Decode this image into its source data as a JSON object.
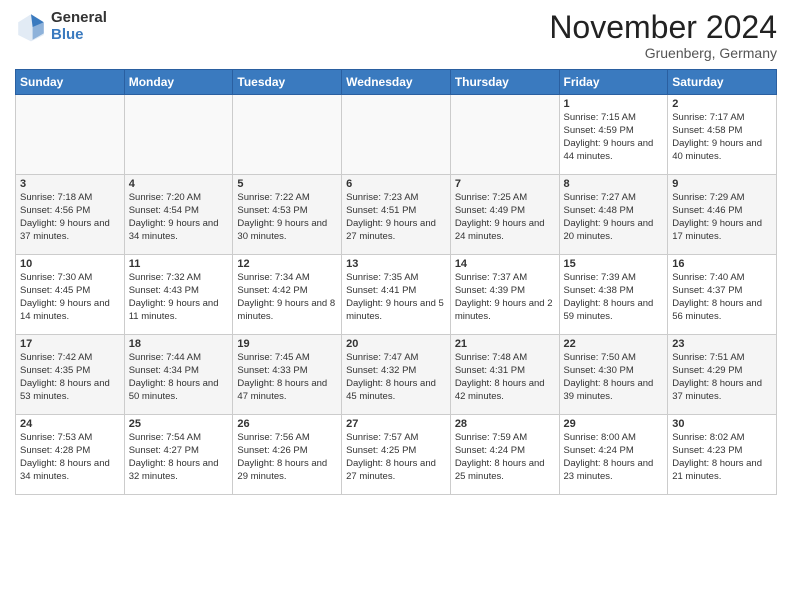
{
  "logo": {
    "general": "General",
    "blue": "Blue"
  },
  "header": {
    "month": "November 2024",
    "location": "Gruenberg, Germany"
  },
  "days_of_week": [
    "Sunday",
    "Monday",
    "Tuesday",
    "Wednesday",
    "Thursday",
    "Friday",
    "Saturday"
  ],
  "weeks": [
    [
      {
        "day": "",
        "info": ""
      },
      {
        "day": "",
        "info": ""
      },
      {
        "day": "",
        "info": ""
      },
      {
        "day": "",
        "info": ""
      },
      {
        "day": "",
        "info": ""
      },
      {
        "day": "1",
        "info": "Sunrise: 7:15 AM\nSunset: 4:59 PM\nDaylight: 9 hours\nand 44 minutes."
      },
      {
        "day": "2",
        "info": "Sunrise: 7:17 AM\nSunset: 4:58 PM\nDaylight: 9 hours\nand 40 minutes."
      }
    ],
    [
      {
        "day": "3",
        "info": "Sunrise: 7:18 AM\nSunset: 4:56 PM\nDaylight: 9 hours\nand 37 minutes."
      },
      {
        "day": "4",
        "info": "Sunrise: 7:20 AM\nSunset: 4:54 PM\nDaylight: 9 hours\nand 34 minutes."
      },
      {
        "day": "5",
        "info": "Sunrise: 7:22 AM\nSunset: 4:53 PM\nDaylight: 9 hours\nand 30 minutes."
      },
      {
        "day": "6",
        "info": "Sunrise: 7:23 AM\nSunset: 4:51 PM\nDaylight: 9 hours\nand 27 minutes."
      },
      {
        "day": "7",
        "info": "Sunrise: 7:25 AM\nSunset: 4:49 PM\nDaylight: 9 hours\nand 24 minutes."
      },
      {
        "day": "8",
        "info": "Sunrise: 7:27 AM\nSunset: 4:48 PM\nDaylight: 9 hours\nand 20 minutes."
      },
      {
        "day": "9",
        "info": "Sunrise: 7:29 AM\nSunset: 4:46 PM\nDaylight: 9 hours\nand 17 minutes."
      }
    ],
    [
      {
        "day": "10",
        "info": "Sunrise: 7:30 AM\nSunset: 4:45 PM\nDaylight: 9 hours\nand 14 minutes."
      },
      {
        "day": "11",
        "info": "Sunrise: 7:32 AM\nSunset: 4:43 PM\nDaylight: 9 hours\nand 11 minutes."
      },
      {
        "day": "12",
        "info": "Sunrise: 7:34 AM\nSunset: 4:42 PM\nDaylight: 9 hours\nand 8 minutes."
      },
      {
        "day": "13",
        "info": "Sunrise: 7:35 AM\nSunset: 4:41 PM\nDaylight: 9 hours\nand 5 minutes."
      },
      {
        "day": "14",
        "info": "Sunrise: 7:37 AM\nSunset: 4:39 PM\nDaylight: 9 hours\nand 2 minutes."
      },
      {
        "day": "15",
        "info": "Sunrise: 7:39 AM\nSunset: 4:38 PM\nDaylight: 8 hours\nand 59 minutes."
      },
      {
        "day": "16",
        "info": "Sunrise: 7:40 AM\nSunset: 4:37 PM\nDaylight: 8 hours\nand 56 minutes."
      }
    ],
    [
      {
        "day": "17",
        "info": "Sunrise: 7:42 AM\nSunset: 4:35 PM\nDaylight: 8 hours\nand 53 minutes."
      },
      {
        "day": "18",
        "info": "Sunrise: 7:44 AM\nSunset: 4:34 PM\nDaylight: 8 hours\nand 50 minutes."
      },
      {
        "day": "19",
        "info": "Sunrise: 7:45 AM\nSunset: 4:33 PM\nDaylight: 8 hours\nand 47 minutes."
      },
      {
        "day": "20",
        "info": "Sunrise: 7:47 AM\nSunset: 4:32 PM\nDaylight: 8 hours\nand 45 minutes."
      },
      {
        "day": "21",
        "info": "Sunrise: 7:48 AM\nSunset: 4:31 PM\nDaylight: 8 hours\nand 42 minutes."
      },
      {
        "day": "22",
        "info": "Sunrise: 7:50 AM\nSunset: 4:30 PM\nDaylight: 8 hours\nand 39 minutes."
      },
      {
        "day": "23",
        "info": "Sunrise: 7:51 AM\nSunset: 4:29 PM\nDaylight: 8 hours\nand 37 minutes."
      }
    ],
    [
      {
        "day": "24",
        "info": "Sunrise: 7:53 AM\nSunset: 4:28 PM\nDaylight: 8 hours\nand 34 minutes."
      },
      {
        "day": "25",
        "info": "Sunrise: 7:54 AM\nSunset: 4:27 PM\nDaylight: 8 hours\nand 32 minutes."
      },
      {
        "day": "26",
        "info": "Sunrise: 7:56 AM\nSunset: 4:26 PM\nDaylight: 8 hours\nand 29 minutes."
      },
      {
        "day": "27",
        "info": "Sunrise: 7:57 AM\nSunset: 4:25 PM\nDaylight: 8 hours\nand 27 minutes."
      },
      {
        "day": "28",
        "info": "Sunrise: 7:59 AM\nSunset: 4:24 PM\nDaylight: 8 hours\nand 25 minutes."
      },
      {
        "day": "29",
        "info": "Sunrise: 8:00 AM\nSunset: 4:24 PM\nDaylight: 8 hours\nand 23 minutes."
      },
      {
        "day": "30",
        "info": "Sunrise: 8:02 AM\nSunset: 4:23 PM\nDaylight: 8 hours\nand 21 minutes."
      }
    ]
  ]
}
